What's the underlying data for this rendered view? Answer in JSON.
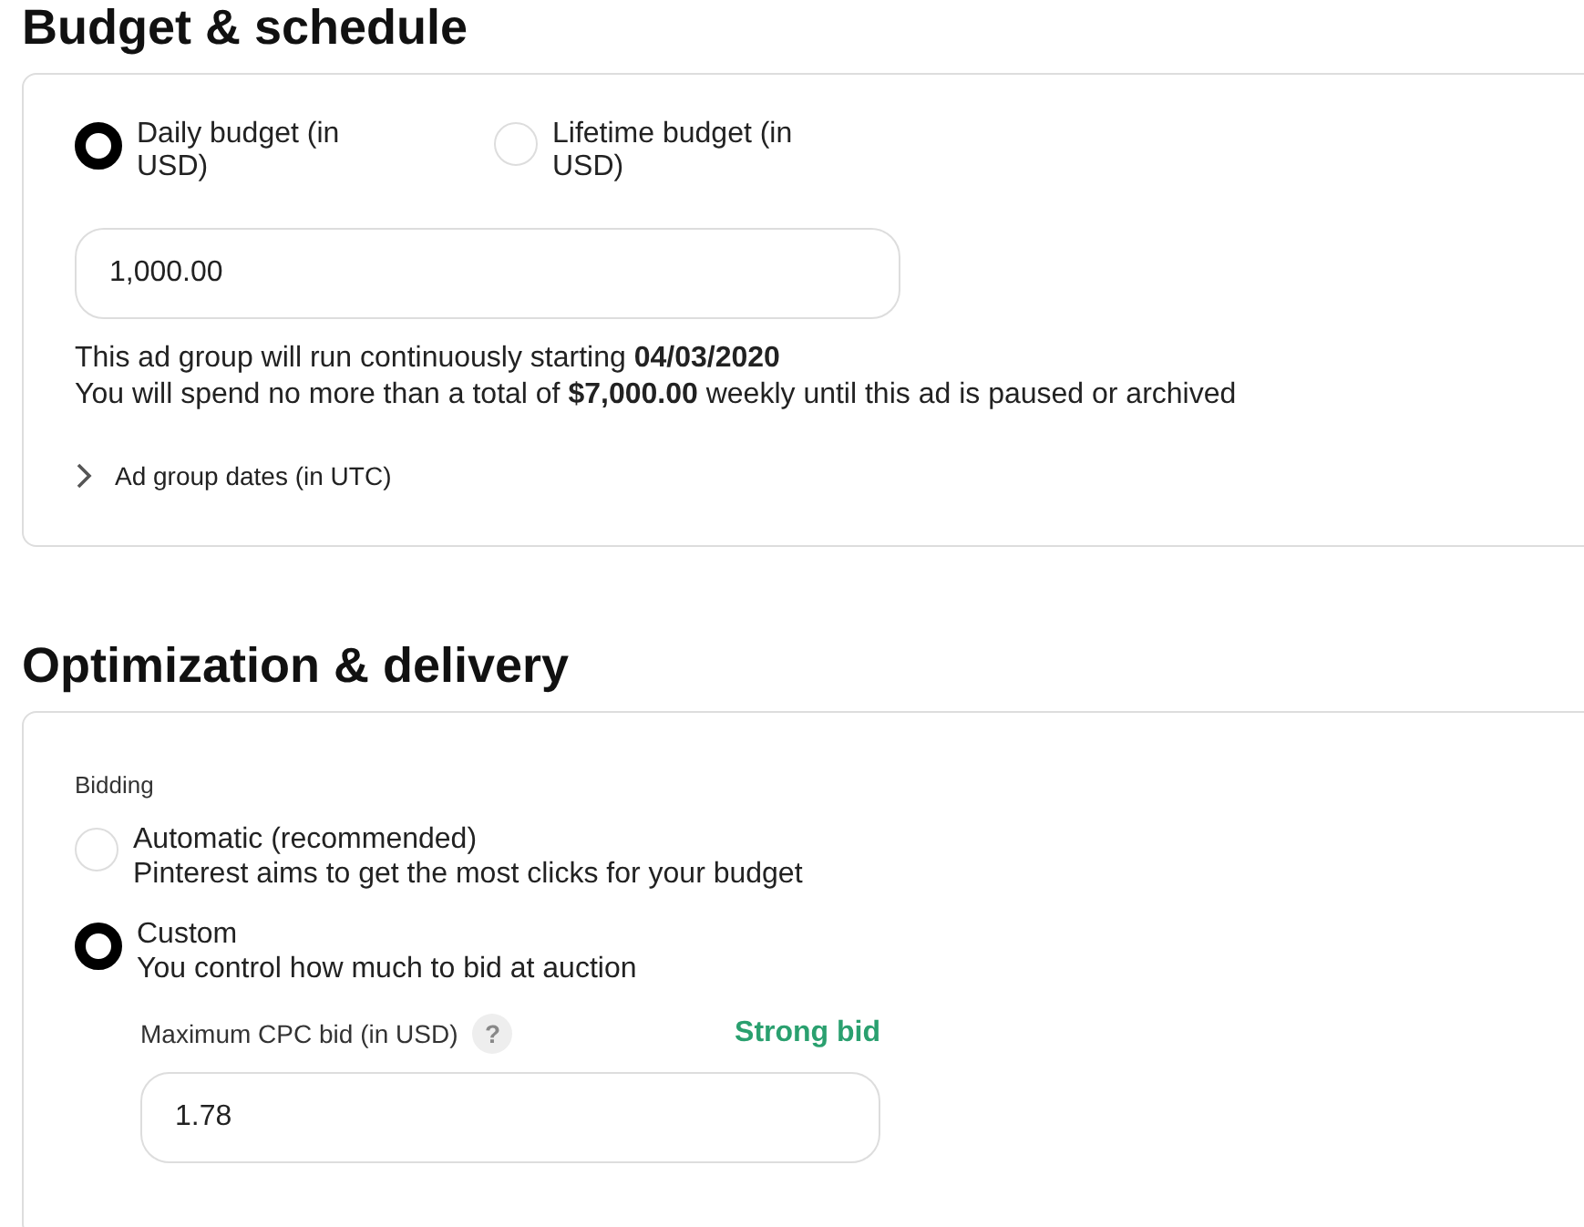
{
  "sections": [
    {
      "title": "Budget & schedule",
      "kind": "budget",
      "budget_options": [
        {
          "label": "Daily budget (in USD)",
          "selected": true
        },
        {
          "label": "Lifetime budget (in USD)",
          "selected": false
        }
      ],
      "budget_field": {
        "value": "1,000.00"
      },
      "notes": [
        "This ad group will run continuously starting **04/03/2020**",
        "You will spend no more than a total of **$7,000.00** weekly until this ad is paused or archived"
      ],
      "expander": {
        "label": "Ad group dates (in UTC)",
        "expanded": false
      }
    },
    {
      "title": "Optimization & delivery",
      "kind": "bidding",
      "group_label": "Bidding",
      "bid_options": [
        {
          "label": "Automatic (recommended)",
          "description": "Pinterest aims to get the most clicks for your budget",
          "selected": false
        },
        {
          "label": "Custom",
          "description": "You control how much to bid at auction",
          "selected": true
        }
      ],
      "bid_field": {
        "label": "Maximum CPC bid (in USD)",
        "help": "?",
        "strength": "Strong bid",
        "value": "1.78"
      }
    }
  ]
}
